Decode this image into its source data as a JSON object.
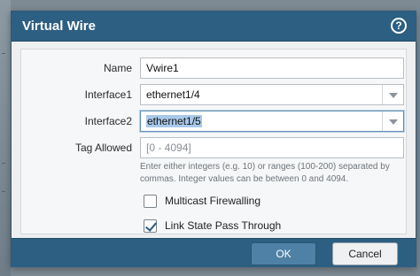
{
  "dialog": {
    "title": "Virtual Wire",
    "help_icon": "help-icon"
  },
  "form": {
    "name": {
      "label": "Name",
      "value": "Vwire1"
    },
    "interface1": {
      "label": "Interface1",
      "value": "ethernet1/4"
    },
    "interface2": {
      "label": "Interface2",
      "value": "ethernet1/5"
    },
    "tag_allowed": {
      "label": "Tag Allowed",
      "placeholder": "[0 - 4094]",
      "help_line1": "Enter either integers (e.g. 10) or ranges (100-200) separated by",
      "help_line2": "commas. Integer values can be between 0 and 4094."
    },
    "multicast_firewalling": {
      "label": "Multicast Firewalling",
      "checked": false
    },
    "link_state_pass_through": {
      "label": "Link State Pass Through",
      "checked": true
    }
  },
  "buttons": {
    "ok": "OK",
    "cancel": "Cancel"
  },
  "colors": {
    "titlebar": "#2c5f82",
    "ok_button": "#4f81a6",
    "selection": "#a8c9ea"
  }
}
